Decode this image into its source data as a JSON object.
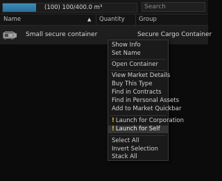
{
  "toolbar": {
    "capacity_text": "(100) 100/400.0 m³",
    "capacity_fraction": 0.25,
    "search_placeholder": "Search"
  },
  "columns": {
    "name": "Name",
    "quantity": "Quantity",
    "group": "Group"
  },
  "items": [
    {
      "name": "Small secure container",
      "group": "Secure Cargo Container",
      "icon": "secure-container-icon"
    }
  ],
  "context_menu": {
    "show_info": "Show Info",
    "set_name": "Set Name",
    "open_container": "Open Container",
    "view_market_details": "View Market Details",
    "buy_this_type": "Buy This Type",
    "find_in_contracts": "Find in Contracts",
    "find_in_personal_assets": "Find in Personal Assets",
    "add_to_market_quickbar": "Add to Market Quickbar",
    "launch_for_corporation": "Launch for Corporation",
    "launch_for_self": "Launch for Self",
    "select_all": "Select All",
    "invert_selection": "Invert Selection",
    "stack_all": "Stack All",
    "warning_mark": "!"
  },
  "colors": {
    "accent": "#2a6d95",
    "warning": "#f0c020",
    "highlight": "#353535"
  }
}
